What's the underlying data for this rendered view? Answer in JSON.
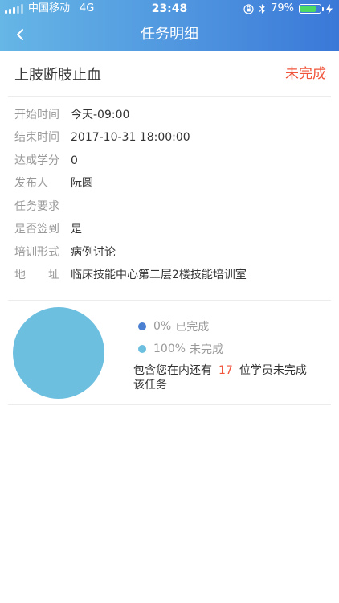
{
  "status_bar": {
    "carrier": "中国移动",
    "network": "4G",
    "time": "23:48",
    "battery_percent": "79%",
    "battery_level": 0.79
  },
  "nav": {
    "back_icon": "chevron-left-icon",
    "title": "任务明细"
  },
  "task": {
    "name": "上肢断肢止血",
    "status": "未完成",
    "status_color": "#f0553b"
  },
  "details": {
    "start_time": {
      "label": "开始时间",
      "value": "今天-09:00"
    },
    "end_time": {
      "label": "结束时间",
      "value": "2017-10-31 18:00:00"
    },
    "credits": {
      "label": "达成学分",
      "value": "0"
    },
    "publisher": {
      "label": "发布人",
      "value": "阮圆"
    },
    "requirements": {
      "label": "任务要求",
      "value": ""
    },
    "sign_in": {
      "label": "是否签到",
      "value": "是"
    },
    "training_type": {
      "label": "培训形式",
      "value": "病例讨论"
    },
    "address": {
      "label_chars": [
        "地",
        "址"
      ],
      "value": "临床技能中心第二层2楼技能培训室"
    }
  },
  "chart_data": {
    "type": "pie",
    "slices": [
      {
        "label": "已完成",
        "value": 0,
        "display": "0%",
        "color": "#4a7fd1"
      },
      {
        "label": "未完成",
        "value": 100,
        "display": "100%",
        "color": "#6dbfe0"
      }
    ]
  },
  "summary": {
    "prefix": "包含您在内还有",
    "count": "17",
    "suffix": "位学员未完成该任务"
  }
}
